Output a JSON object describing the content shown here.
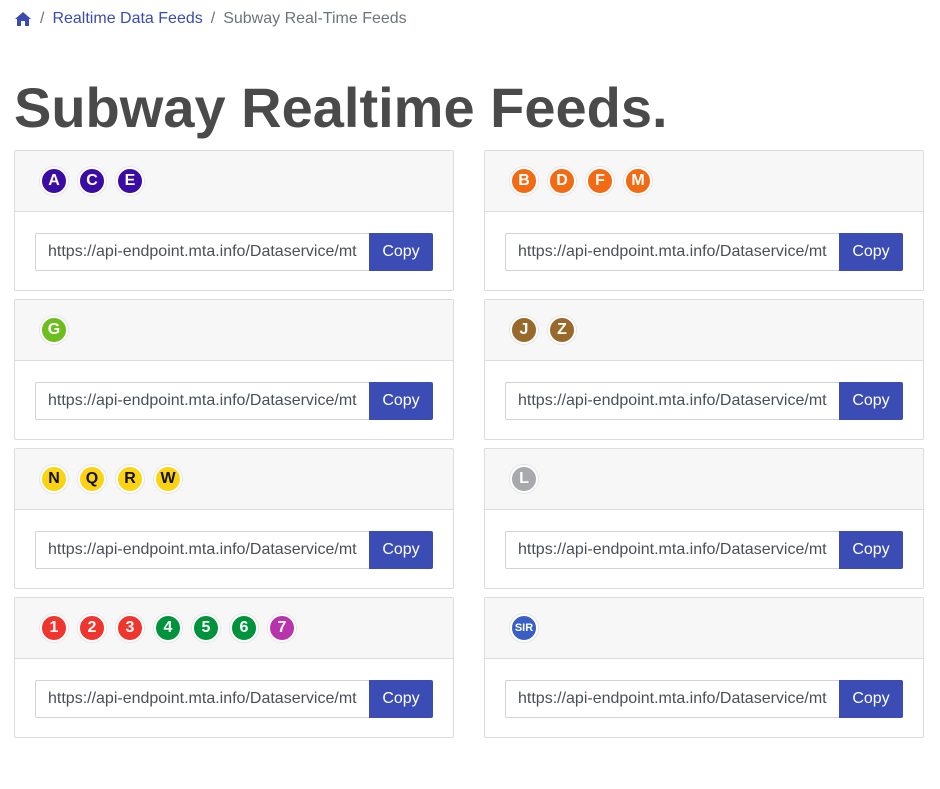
{
  "breadcrumb": {
    "home_icon": "home-icon",
    "sep1": "/",
    "link": "Realtime Data Feeds",
    "sep2": "/",
    "current": "Subway Real-Time Feeds"
  },
  "page_title": "Subway Realtime Feeds.",
  "copy_label": "Copy",
  "feeds": [
    {
      "lines": [
        {
          "label": "A",
          "bg": "#3a0ca3",
          "fg": "#ffffff"
        },
        {
          "label": "C",
          "bg": "#3a0ca3",
          "fg": "#ffffff"
        },
        {
          "label": "E",
          "bg": "#3a0ca3",
          "fg": "#ffffff"
        }
      ],
      "url": "https://api-endpoint.mta.info/Dataservice/mt"
    },
    {
      "lines": [
        {
          "label": "B",
          "bg": "#f26a12",
          "fg": "#ffffff"
        },
        {
          "label": "D",
          "bg": "#f26a12",
          "fg": "#ffffff"
        },
        {
          "label": "F",
          "bg": "#f26a12",
          "fg": "#ffffff"
        },
        {
          "label": "M",
          "bg": "#f26a12",
          "fg": "#ffffff"
        }
      ],
      "url": "https://api-endpoint.mta.info/Dataservice/mt"
    },
    {
      "lines": [
        {
          "label": "G",
          "bg": "#6cbe1e",
          "fg": "#ffffff"
        }
      ],
      "url": "https://api-endpoint.mta.info/Dataservice/mt"
    },
    {
      "lines": [
        {
          "label": "J",
          "bg": "#99682b",
          "fg": "#ffffff"
        },
        {
          "label": "Z",
          "bg": "#99682b",
          "fg": "#ffffff"
        }
      ],
      "url": "https://api-endpoint.mta.info/Dataservice/mt"
    },
    {
      "lines": [
        {
          "label": "N",
          "bg": "#fbd312",
          "fg": "#111111"
        },
        {
          "label": "Q",
          "bg": "#fbd312",
          "fg": "#111111"
        },
        {
          "label": "R",
          "bg": "#fbd312",
          "fg": "#111111"
        },
        {
          "label": "W",
          "bg": "#fbd312",
          "fg": "#111111"
        }
      ],
      "url": "https://api-endpoint.mta.info/Dataservice/mt"
    },
    {
      "lines": [
        {
          "label": "L",
          "bg": "#a7a9ac",
          "fg": "#ffffff"
        }
      ],
      "url": "https://api-endpoint.mta.info/Dataservice/mt"
    },
    {
      "lines": [
        {
          "label": "1",
          "bg": "#ee352e",
          "fg": "#ffffff"
        },
        {
          "label": "2",
          "bg": "#ee352e",
          "fg": "#ffffff"
        },
        {
          "label": "3",
          "bg": "#ee352e",
          "fg": "#ffffff"
        },
        {
          "label": "4",
          "bg": "#00933c",
          "fg": "#ffffff"
        },
        {
          "label": "5",
          "bg": "#00933c",
          "fg": "#ffffff"
        },
        {
          "label": "6",
          "bg": "#00933c",
          "fg": "#ffffff"
        },
        {
          "label": "7",
          "bg": "#b933ad",
          "fg": "#ffffff"
        }
      ],
      "url": "https://api-endpoint.mta.info/Dataservice/mt"
    },
    {
      "lines": [
        {
          "label": "SIR",
          "bg": "#3a5fc4",
          "fg": "#ffffff"
        }
      ],
      "url": "https://api-endpoint.mta.info/Dataservice/mt"
    }
  ]
}
